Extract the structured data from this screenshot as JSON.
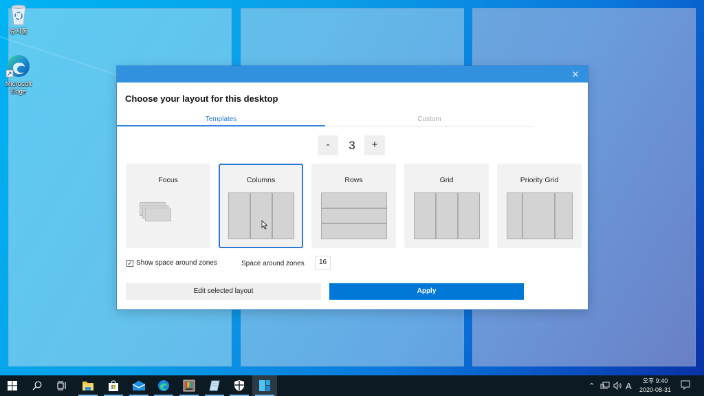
{
  "desktop": {
    "icons": [
      {
        "name": "recycle-bin",
        "label": "휴지통"
      },
      {
        "name": "microsoft-edge",
        "label": "Microsoft Edge"
      }
    ],
    "zone_count_overlay": 3
  },
  "dialog": {
    "close_icon": "✕",
    "title": "Choose your layout for this desktop",
    "tabs": [
      {
        "label": "Templates",
        "active": true
      },
      {
        "label": "Custom",
        "active": false
      }
    ],
    "zone_count": {
      "minus_label": "-",
      "value": "3",
      "plus_label": "+"
    },
    "layouts": [
      {
        "id": "focus",
        "label": "Focus",
        "selected": false
      },
      {
        "id": "columns",
        "label": "Columns",
        "selected": true
      },
      {
        "id": "rows",
        "label": "Rows",
        "selected": false
      },
      {
        "id": "grid",
        "label": "Grid",
        "selected": false
      },
      {
        "id": "priority-grid",
        "label": "Priority Grid",
        "selected": false
      }
    ],
    "show_space_checkbox": {
      "label": "Show space around zones",
      "checked": true,
      "check_glyph": "✓"
    },
    "space_around_zones": {
      "label": "Space around zones",
      "value": "16"
    },
    "edit_button": "Edit selected layout",
    "apply_button": "Apply",
    "accent_color": "#0078d7"
  },
  "taskbar": {
    "items": [
      {
        "name": "start",
        "running": false
      },
      {
        "name": "search",
        "running": false
      },
      {
        "name": "task-view",
        "running": false
      },
      {
        "name": "file-explorer",
        "running": true
      },
      {
        "name": "microsoft-store",
        "running": true
      },
      {
        "name": "mail",
        "running": true
      },
      {
        "name": "edge",
        "running": true
      },
      {
        "name": "powertoys-color-picker",
        "running": true
      },
      {
        "name": "notepad",
        "running": true
      },
      {
        "name": "windows-security",
        "running": true
      },
      {
        "name": "fancyzones",
        "running": true,
        "active": true
      }
    ],
    "tray": {
      "chevron": "^",
      "ime": "A",
      "time": "오후 9:40",
      "date": "2020-08-31"
    }
  }
}
